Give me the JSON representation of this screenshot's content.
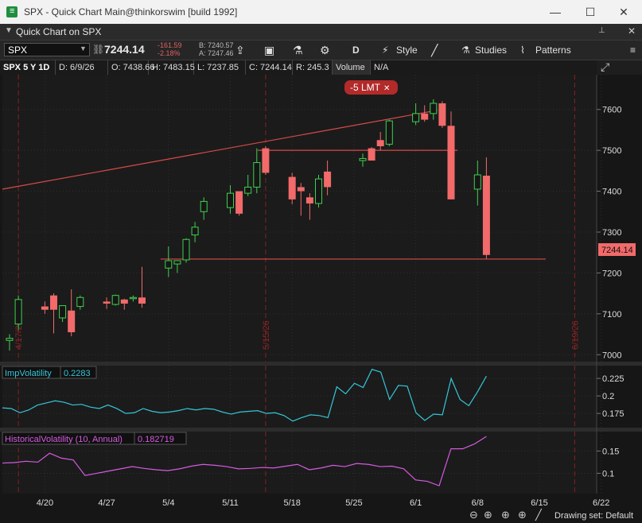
{
  "window": {
    "title": "SPX - Quick Chart Main@thinkorswim [build 1992]",
    "minimize": "—",
    "maximize": "☐",
    "close": "✕"
  },
  "header": {
    "label": "Quick Chart on SPX",
    "pin": "📌",
    "close": "✕"
  },
  "toolbar": {
    "symbol": "SPX",
    "price": "7244.14",
    "change": "-161.59",
    "change_pct": "-2.18%",
    "bid": "B: 7240.57",
    "ask": "A: 7247.46",
    "aggregation": "D",
    "style_label": "Style",
    "studies_label": "Studies",
    "patterns_label": "Patterns"
  },
  "infobar": {
    "descriptor": "SPX 5 Y 1D",
    "date": "D: 6/9/26",
    "open": "O: 7438.66",
    "high": "H: 7483.15",
    "low": "L: 7237.85",
    "close": "C: 7244.14",
    "range": "R: 245.3",
    "volume": "Volume",
    "volume_val": "N/A"
  },
  "order_tag": {
    "label": "-5 LMT",
    "close": "✕"
  },
  "price_tag": "7244.14",
  "chart_data": [
    {
      "type": "candlestick",
      "title": "SPX 5 Y 1D",
      "y_ticks": [
        7000,
        7100,
        7200,
        7300,
        7400,
        7500,
        7600
      ],
      "ylim": [
        6983,
        7685
      ],
      "x_ticks": [
        "4/20",
        "4/27",
        "5/4",
        "5/11",
        "5/18",
        "5/25",
        "6/1",
        "6/8",
        "6/15",
        "6/22"
      ],
      "period_markers": [
        "4/17/26",
        "5/15/26",
        "6/19/26"
      ],
      "dates": [
        "4/16",
        "4/17",
        "4/20",
        "4/21",
        "4/22",
        "4/23",
        "4/24",
        "4/27",
        "4/28",
        "4/29",
        "4/30",
        "5/1",
        "5/4",
        "5/5",
        "5/6",
        "5/7",
        "5/8",
        "5/11",
        "5/12",
        "5/13",
        "5/14",
        "5/15",
        "5/18",
        "5/19",
        "5/20",
        "5/21",
        "5/22",
        "5/26",
        "5/27",
        "5/28",
        "5/29",
        "6/1",
        "6/2",
        "6/3",
        "6/4",
        "6/5",
        "6/8",
        "6/9"
      ],
      "open": [
        7035,
        7075,
        7118,
        7145,
        7090,
        7108,
        7118,
        7130,
        7123,
        7135,
        7138,
        7140,
        7212,
        7222,
        7232,
        7293,
        7350,
        7360,
        7400,
        7395,
        7410,
        7505,
        7435,
        7410,
        7385,
        7370,
        7448,
        7475,
        7505,
        7525,
        7515,
        7570,
        7590,
        7590,
        7615,
        7560,
        7405,
        7438
      ],
      "high": [
        7050,
        7145,
        7130,
        7150,
        7110,
        7160,
        7145,
        7140,
        7147,
        7137,
        7145,
        7215,
        7265,
        7230,
        7285,
        7325,
        7385,
        7415,
        7398,
        7440,
        7505,
        7510,
        7445,
        7420,
        7395,
        7440,
        7475,
        7492,
        7508,
        7545,
        7575,
        7615,
        7610,
        7625,
        7620,
        7595,
        7475,
        7483
      ],
      "low": [
        7010,
        7060,
        7100,
        7052,
        7080,
        7045,
        7110,
        7112,
        7120,
        7110,
        7130,
        7115,
        7190,
        7200,
        7225,
        7275,
        7330,
        7345,
        7340,
        7388,
        7395,
        7440,
        7368,
        7340,
        7330,
        7360,
        7390,
        7460,
        7475,
        7500,
        7510,
        7562,
        7570,
        7575,
        7555,
        7535,
        7365,
        7235
      ],
      "close": [
        7040,
        7135,
        7110,
        7110,
        7120,
        7055,
        7140,
        7125,
        7145,
        7125,
        7140,
        7125,
        7230,
        7230,
        7282,
        7312,
        7375,
        7395,
        7345,
        7410,
        7470,
        7445,
        7380,
        7400,
        7370,
        7430,
        7410,
        7480,
        7475,
        7510,
        7572,
        7590,
        7575,
        7615,
        7560,
        7380,
        7440,
        7244
      ],
      "annotations": [
        {
          "type": "trendline",
          "from": [
            "4/16",
            7405
          ],
          "to": [
            "6/3",
            7598
          ]
        },
        {
          "type": "level",
          "value": 7500,
          "from": "5/15",
          "to": "6/5"
        },
        {
          "type": "level",
          "value": 7234,
          "from": "5/4",
          "to": "6/15"
        }
      ]
    },
    {
      "type": "line",
      "title": "ImpVolatility",
      "value_label": "0.2283",
      "y_ticks": [
        0.175,
        0.2,
        0.225
      ],
      "ylim": [
        0.157,
        0.241
      ],
      "values": [
        0.183,
        0.182,
        0.176,
        0.18,
        0.187,
        0.19,
        0.193,
        0.191,
        0.187,
        0.188,
        0.184,
        0.182,
        0.187,
        0.182,
        0.175,
        0.176,
        0.182,
        0.178,
        0.176,
        0.177,
        0.179,
        0.182,
        0.18,
        0.182,
        0.181,
        0.177,
        0.174,
        0.177,
        0.178,
        0.179,
        0.175,
        0.176,
        0.172,
        0.164,
        0.169,
        0.173,
        0.172,
        0.169,
        0.213,
        0.203,
        0.218,
        0.212,
        0.238,
        0.234,
        0.195,
        0.215,
        0.214,
        0.176,
        0.165,
        0.174,
        0.173,
        0.225,
        0.195,
        0.186,
        0.206,
        0.2283
      ]
    },
    {
      "type": "line",
      "title": "HistoricalVolatility (10, Annual)",
      "value_label": "0.182719",
      "y_ticks": [
        0.1,
        0.15
      ],
      "ylim": [
        0.058,
        0.19
      ],
      "values": [
        0.123,
        0.124,
        0.127,
        0.125,
        0.145,
        0.134,
        0.13,
        0.095,
        0.1,
        0.105,
        0.11,
        0.115,
        0.111,
        0.108,
        0.106,
        0.11,
        0.116,
        0.12,
        0.118,
        0.115,
        0.11,
        0.111,
        0.113,
        0.112,
        0.116,
        0.12,
        0.108,
        0.112,
        0.118,
        0.115,
        0.122,
        0.12,
        0.115,
        0.116,
        0.11,
        0.085,
        0.082,
        0.072,
        0.155,
        0.155,
        0.166,
        0.182719
      ]
    }
  ]
}
